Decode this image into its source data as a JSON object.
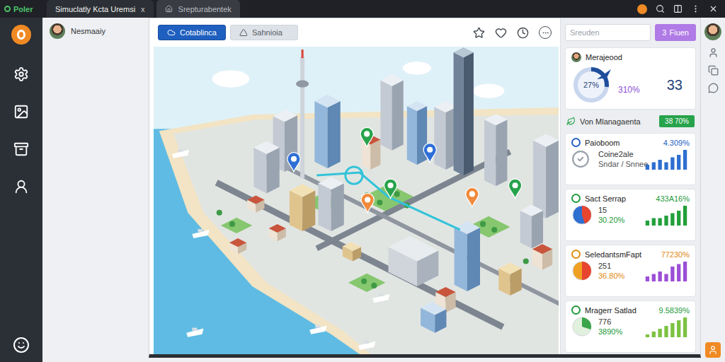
{
  "browser": {
    "brand": "Poler",
    "tabs": [
      {
        "label": "Simuclatly Kcta Uremsi",
        "close": "x",
        "selected": true
      },
      {
        "label": "Srepturabentek",
        "selected": false
      }
    ]
  },
  "user": {
    "name": "Nesmaaiy"
  },
  "view_tabs": [
    {
      "label": "Cotablinca",
      "selected": true
    },
    {
      "label": "Sahnioia",
      "selected": false
    }
  ],
  "search": {
    "placeholder": "Sreuden"
  },
  "action_button": {
    "count": "3",
    "label": "Fiuen"
  },
  "summary": {
    "title": "Merajeood",
    "gauge_text": "27%",
    "level": 0.27,
    "percent": "310%",
    "count": "33"
  },
  "section": {
    "title": "Von Mlanagaenta",
    "badge": "38 70%"
  },
  "items": [
    {
      "title": "Paioboom",
      "value": "4.309%",
      "color": "#2461c4",
      "kind": "text",
      "primary": "Coine2ale",
      "secondary": "Sndar / Snnee",
      "bar_color": "#2e6fd0",
      "bars": [
        2,
        3,
        4,
        3,
        5,
        6,
        8
      ]
    },
    {
      "title": "Sact Serrap",
      "value": "433A16%",
      "color": "#1e9a3c",
      "kind": "pie",
      "primary": "15",
      "secondary": "30.20%",
      "level": 0.45,
      "pie_colors": [
        "#e8452f",
        "#2e6fd0"
      ],
      "bar_color": "#22a03a",
      "bars": [
        2,
        3,
        3,
        4,
        5,
        6,
        8
      ]
    },
    {
      "title": "SeledantsmFapt",
      "value": "77230%",
      "color": "#e08a12",
      "kind": "pie",
      "primary": "251",
      "secondary": "36.80%",
      "level": 0.5,
      "pie_colors": [
        "#e8452f",
        "#f0a020"
      ],
      "bar_color": "#9b4fd6",
      "bars": [
        2,
        3,
        4,
        3,
        6,
        7,
        8
      ]
    },
    {
      "title": "Mragerr Satlad",
      "value": "9.5839%",
      "color": "#1e9a3c",
      "kind": "pie",
      "primary": "776",
      "secondary": "3890%",
      "level": 0.3,
      "pie_colors": [
        "#3aa54a",
        "#e2f0de"
      ],
      "bar_color": "#7cc242",
      "bars": [
        1,
        2,
        3,
        4,
        5,
        6,
        7
      ]
    }
  ],
  "map": {
    "pins": [
      {
        "color": "#2f6fd6"
      },
      {
        "color": "#27a34b"
      },
      {
        "color": "#2f6fd6"
      },
      {
        "color": "#f08a3c"
      },
      {
        "color": "#27a34b"
      },
      {
        "color": "#f08a3c"
      },
      {
        "color": "#27a34b"
      }
    ]
  }
}
